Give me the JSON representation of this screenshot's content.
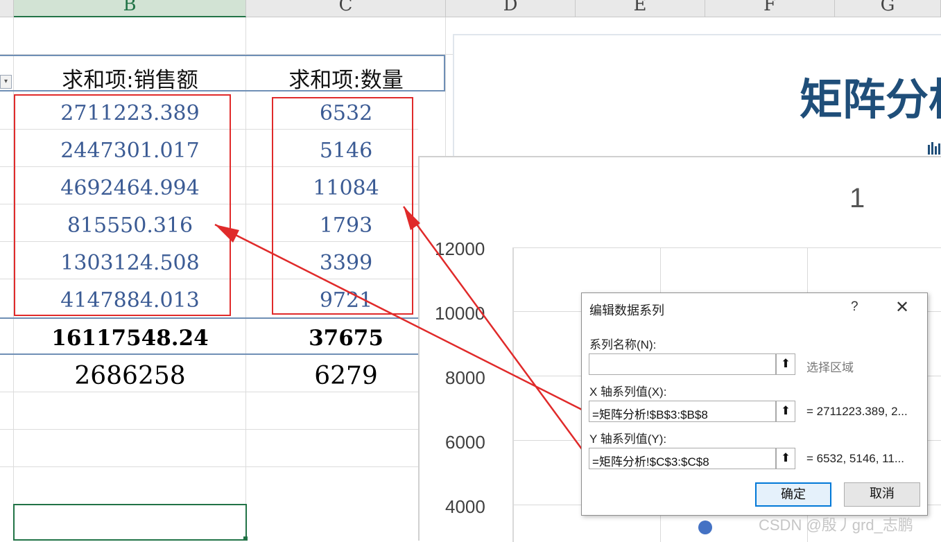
{
  "columns": [
    "B",
    "C",
    "D",
    "E",
    "F",
    "G"
  ],
  "pivot": {
    "headers": [
      "求和项:销售额",
      "求和项:数量"
    ],
    "rows": [
      [
        "2711223.389",
        "6532"
      ],
      [
        "2447301.017",
        "5146"
      ],
      [
        "4692464.994",
        "11084"
      ],
      [
        "815550.316",
        "1793"
      ],
      [
        "1303124.508",
        "3399"
      ],
      [
        "4147884.013",
        "9721"
      ]
    ],
    "totals": [
      "16117548.24",
      "37675"
    ],
    "averages": [
      "2686258",
      "6279"
    ]
  },
  "title_panel": {
    "title": "矩阵分析"
  },
  "chart": {
    "title": "1",
    "yticks": [
      "12000",
      "10000",
      "8000",
      "6000",
      "4000"
    ],
    "point_color": "#4472c4"
  },
  "dialog": {
    "title": "编辑数据系列",
    "help": "?",
    "close": "✕",
    "series_name_label": "系列名称(N):",
    "series_name_value": "",
    "select_range": "选择区域",
    "x_label": "X 轴系列值(X):",
    "x_value": "=矩阵分析!$B$3:$B$8",
    "x_preview": "= 2711223.389, 2...",
    "y_label": "Y 轴系列值(Y):",
    "y_value": "=矩阵分析!$C$3:$C$8",
    "y_preview": "= 6532, 5146, 11...",
    "ok": "确定",
    "cancel": "取消"
  },
  "watermark": "CSDN @殷丿grd_志鹏",
  "colors": {
    "accent_red": "#e02a2a",
    "number_blue": "#3b5b94",
    "title_blue": "#1f4e79",
    "excel_green": "#217346"
  }
}
